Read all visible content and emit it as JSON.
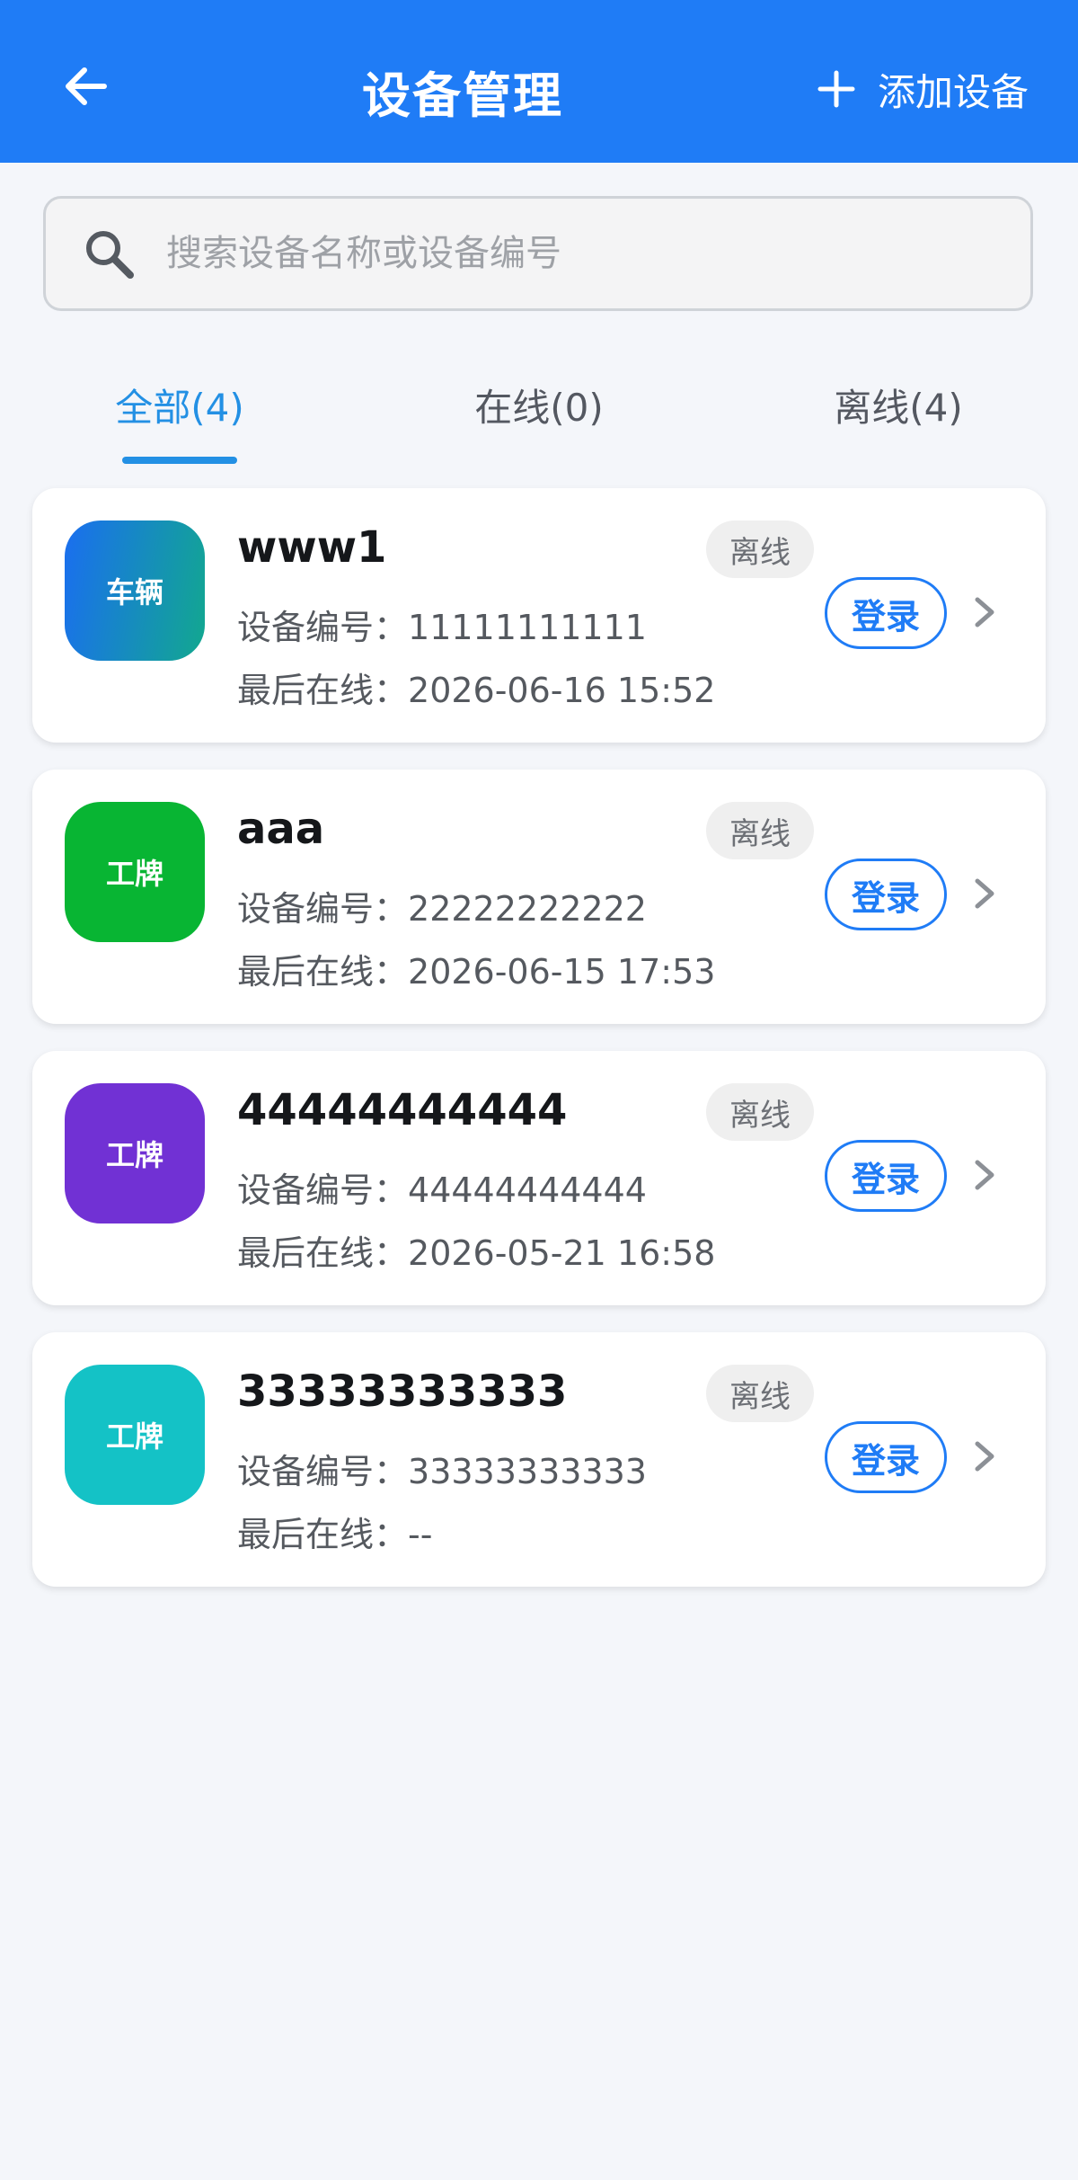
{
  "header": {
    "title": "设备管理",
    "add_label": "添加设备",
    "back_icon": "arrow-left-icon",
    "add_icon": "plus-icon",
    "color": "#1f7cf6"
  },
  "search": {
    "placeholder": "搜索设备名称或设备编号",
    "value": "",
    "icon": "search-icon"
  },
  "tabs": [
    {
      "label": "全部(4)",
      "active": true
    },
    {
      "label": "在线(0)",
      "active": false
    },
    {
      "label": "离线(4)",
      "active": false
    }
  ],
  "devices": [
    {
      "avatar_label": "车辆",
      "avatar_color": "gradient #1a6ef0 → #12a88f",
      "name": "www1",
      "status": "离线",
      "id_label": "设备编号：",
      "id": "11111111111",
      "last_label": "最后在线：",
      "last_online": "2026-06-16 15:52",
      "login_label": "登录"
    },
    {
      "avatar_label": "工牌",
      "avatar_color": "#08b533",
      "name": "aaa",
      "status": "离线",
      "id_label": "设备编号：",
      "id": "22222222222",
      "last_label": "最后在线：",
      "last_online": "2026-06-15 17:53",
      "login_label": "登录"
    },
    {
      "avatar_label": "工牌",
      "avatar_color": "#7131d4",
      "name": "44444444444",
      "status": "离线",
      "id_label": "设备编号：",
      "id": "44444444444",
      "last_label": "最后在线：",
      "last_online": "2026-05-21 16:58",
      "login_label": "登录"
    },
    {
      "avatar_label": "工牌",
      "avatar_color": "#14c2c6",
      "name": "33333333333",
      "status": "离线",
      "id_label": "设备编号：",
      "id": "33333333333",
      "last_label": "最后在线：",
      "last_online": "--",
      "login_label": "登录"
    }
  ]
}
